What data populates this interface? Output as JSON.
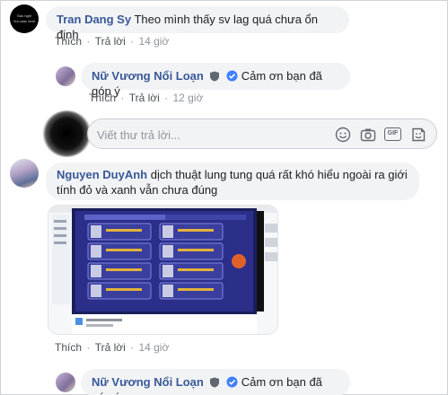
{
  "comments": [
    {
      "author": "Tran Dang Sy",
      "text": "Theo mình thấy sv lag quá chưa ổn định",
      "avatar_text": [
        "Sao nghĩ",
        "Vui cuộc chơi"
      ],
      "actions": {
        "like": "Thích",
        "reply": "Trả lời",
        "time": "14 giờ"
      }
    },
    {
      "author": "Nữ Vương Nổi Loạn",
      "text": "Cảm ơn bạn đã góp ý",
      "actions": {
        "like": "Thích",
        "reply": "Trả lời",
        "time": "12 giờ"
      }
    },
    {
      "author": "Nguyen DuyAnh",
      "text": "dịch thuật lung tung quá rất khó hiểu ngoài ra giới tính đỏ và xanh vẫn chưa đúng",
      "actions": {
        "like": "Thích",
        "reply": "Trả lời",
        "time": "14 giờ"
      }
    },
    {
      "author": "Nữ Vương Nổi Loạn",
      "text": "Cảm ơn bạn đã góp ý"
    }
  ],
  "reply_box": {
    "placeholder": "Viết thư trả lời...",
    "icons": [
      "emoji-icon",
      "camera-icon",
      "gif-icon",
      "sticker-icon"
    ],
    "gif_label": "GIF"
  },
  "colors": {
    "link": "#385898",
    "bubble": "#f2f3f5",
    "verified": "#4080ff",
    "muted": "#90949c"
  }
}
